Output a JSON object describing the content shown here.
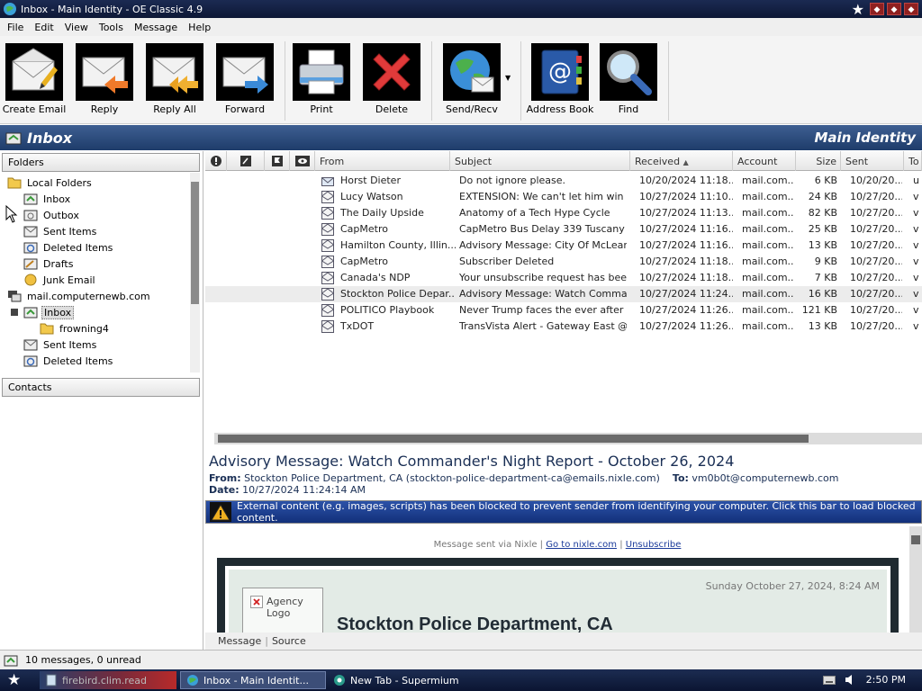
{
  "window": {
    "title": "Inbox - Main Identity - OE Classic 4.9"
  },
  "menu": [
    "File",
    "Edit",
    "View",
    "Tools",
    "Message",
    "Help"
  ],
  "toolbar": {
    "create_email": "Create Email",
    "reply": "Reply",
    "reply_all": "Reply All",
    "forward": "Forward",
    "print": "Print",
    "delete": "Delete",
    "send_recv": "Send/Recv",
    "address_book": "Address Book",
    "find": "Find"
  },
  "folder_header": {
    "title": "Inbox",
    "identity": "Main Identity"
  },
  "left_pane": {
    "folders_label": "Folders",
    "contacts_label": "Contacts",
    "tree": [
      {
        "label": "Local Folders",
        "icon": "folder-icon"
      },
      {
        "label": "Inbox",
        "icon": "inbox-icon"
      },
      {
        "label": "Outbox",
        "icon": "outbox-icon"
      },
      {
        "label": "Sent Items",
        "icon": "sent-items-icon"
      },
      {
        "label": "Deleted Items",
        "icon": "deleted-items-icon"
      },
      {
        "label": "Drafts",
        "icon": "drafts-icon"
      },
      {
        "label": "Junk Email",
        "icon": "junk-email-icon"
      },
      {
        "label": "mail.computernewb.com",
        "icon": "account-icon"
      },
      {
        "label": "Inbox",
        "icon": "inbox-icon"
      },
      {
        "label": "frowning4",
        "icon": "folder-icon"
      },
      {
        "label": "Sent Items",
        "icon": "sent-items-icon"
      },
      {
        "label": "Deleted Items",
        "icon": "deleted-items-icon"
      }
    ]
  },
  "message_list": {
    "columns": {
      "from": "From",
      "subject": "Subject",
      "received": "Received",
      "account": "Account",
      "size": "Size",
      "sent": "Sent",
      "to": "To"
    },
    "rows": [
      {
        "from": "Horst Dieter",
        "subject": "Do not ignore please.",
        "received": "10/20/2024 11:18...",
        "account": "mail.com...",
        "size": "6 KB",
        "sent": "10/20/20...",
        "to": "u"
      },
      {
        "from": "Lucy Watson",
        "subject": "EXTENSION: We can't let him win now.",
        "received": "10/27/2024 11:10...",
        "account": "mail.com...",
        "size": "24 KB",
        "sent": "10/27/20...",
        "to": "v"
      },
      {
        "from": "The Daily Upside",
        "subject": "Anatomy of a Tech Hype Cycle",
        "received": "10/27/2024 11:13...",
        "account": "mail.com...",
        "size": "82 KB",
        "sent": "10/27/20...",
        "to": "v"
      },
      {
        "from": "CapMetro",
        "subject": "CapMetro Bus Delay 339 Tuscany",
        "received": "10/27/2024 11:16...",
        "account": "mail.com...",
        "size": "25 KB",
        "sent": "10/27/20...",
        "to": "v"
      },
      {
        "from": "Hamilton County, Illin...",
        "subject": "Advisory Message: City Of McLeans...",
        "received": "10/27/2024 11:16...",
        "account": "mail.com...",
        "size": "13 KB",
        "sent": "10/27/20...",
        "to": "v"
      },
      {
        "from": "CapMetro",
        "subject": "Subscriber Deleted",
        "received": "10/27/2024 11:18...",
        "account": "mail.com...",
        "size": "9 KB",
        "sent": "10/27/20...",
        "to": "v"
      },
      {
        "from": "Canada's NDP",
        "subject": "Your unsubscribe request has been ...",
        "received": "10/27/2024 11:18...",
        "account": "mail.com...",
        "size": "7 KB",
        "sent": "10/27/20...",
        "to": "v"
      },
      {
        "from": "Stockton Police Depar...",
        "subject": "Advisory Message: Watch Comman...",
        "received": "10/27/2024 11:24...",
        "account": "mail.com...",
        "size": "16 KB",
        "sent": "10/27/20...",
        "to": "v"
      },
      {
        "from": "POLITICO Playbook",
        "subject": "Never Trump faces the ever after",
        "received": "10/27/2024 11:26...",
        "account": "mail.com...",
        "size": "121 KB",
        "sent": "10/27/20...",
        "to": "v"
      },
      {
        "from": "TxDOT",
        "subject": "TransVista Alert - Gateway East @ ...",
        "received": "10/27/2024 11:26...",
        "account": "mail.com...",
        "size": "13 KB",
        "sent": "10/27/20...",
        "to": "v"
      }
    ]
  },
  "preview": {
    "subject": "Advisory Message: Watch Commander's Night Report - October 26, 2024",
    "from_label": "From:",
    "from_name": "Stockton Police Department, CA",
    "from_email": "(stockton-police-department-ca@emails.nixle.com)",
    "to_label": "To:",
    "to_value": "vm0b0t@computernewb.com",
    "date_label": "Date:",
    "date_value": "10/27/2024 11:24:14 AM",
    "blocked_notice": "External content (e.g. images, scripts) has been blocked to prevent sender from identifying your computer. Click this bar to load blocked content.",
    "nixle_text": "Message sent via Nixle |",
    "nixle_link": "Go to nixle.com",
    "nixle_sep": "|",
    "unsubscribe": "Unsubscribe",
    "agency_logo": "Agency Logo",
    "email_date": "Sunday October 27, 2024, 8:24 AM",
    "email_title": "Stockton Police Department, CA",
    "tab_message": "Message",
    "tab_source": "Source"
  },
  "status": {
    "text": "10 messages, 0 unread"
  },
  "taskbar": {
    "task1": "firebird.clim.read",
    "task2": "Inbox - Main Identit...",
    "task3": "New Tab - Supermium",
    "clock": "2:50 PM"
  },
  "colors": {
    "header_blue": "#2a4a7c",
    "block_bar": "#1e3f94",
    "title_bar": "#15224a"
  }
}
